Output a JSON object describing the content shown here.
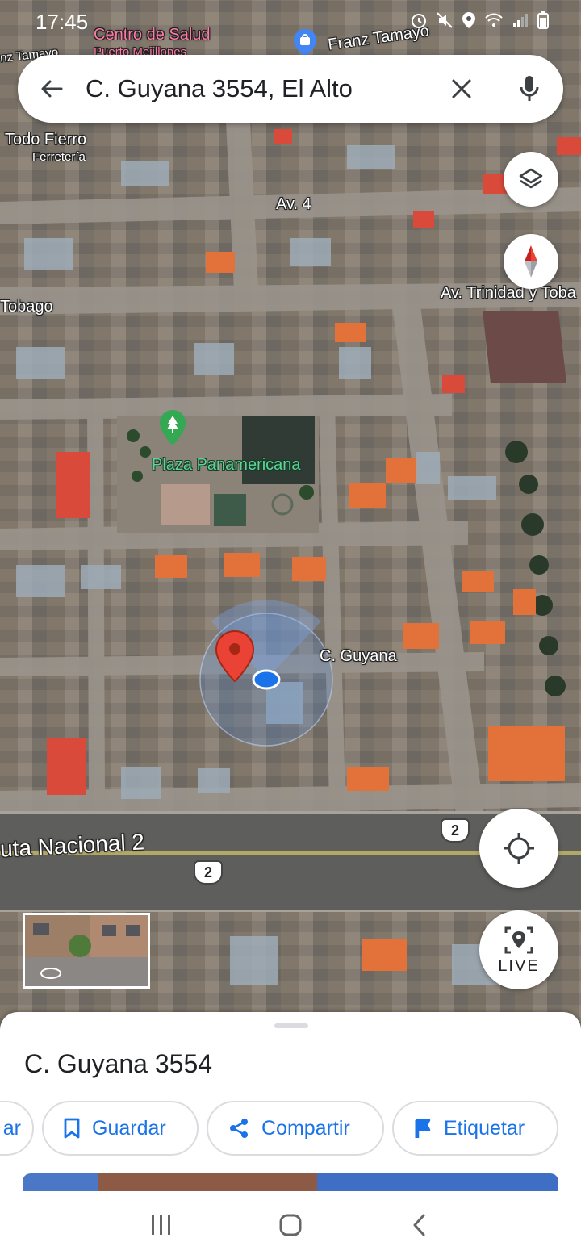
{
  "status_bar": {
    "time": "17:45"
  },
  "search": {
    "query": "C. Guyana 3554, El Alto"
  },
  "map": {
    "labels": {
      "centro_salud_1": "Centro de Salud",
      "centro_salud_2": "Puerto Mejillones",
      "franz_tamayo_top": "Franz Tamayo",
      "franz_tamayo_left": "nz Tamayo",
      "todo_fierro": "Todo Fierro",
      "ferreteria": "Ferretería",
      "av4": "Av. 4",
      "tobago_left": "Tobago",
      "trinidad_tobago": "Av. Trinidad y Toba",
      "plaza": "Plaza Panamericana",
      "c_guyana": "C. Guyana",
      "ruta_nacional": "uta Nacional 2",
      "route_shield_1": "2",
      "route_shield_2": "2"
    }
  },
  "controls": {
    "live_label": "LIVE"
  },
  "place_sheet": {
    "title": "C. Guyana 3554",
    "actions": {
      "partial": "ar",
      "save": "Guardar",
      "share": "Compartir",
      "label": "Etiquetar"
    }
  },
  "colors": {
    "accent": "#1a73e8",
    "pin": "#ea4335",
    "location_dot": "#1a73e8"
  }
}
